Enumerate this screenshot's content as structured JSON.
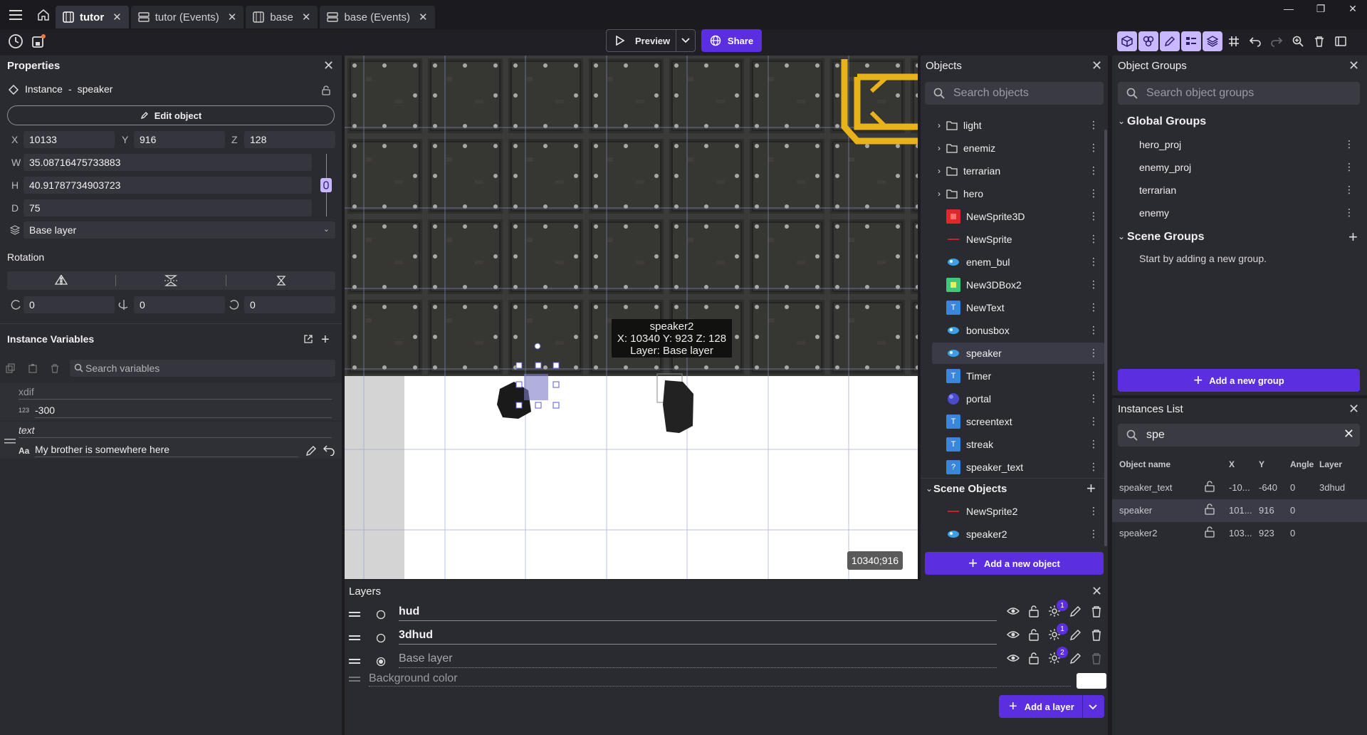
{
  "tabs": [
    {
      "label": "tutor",
      "active": true,
      "icon": "film-icon"
    },
    {
      "label": "tutor (Events)",
      "active": false,
      "icon": "list-icon"
    },
    {
      "label": "base",
      "active": false,
      "icon": "film-icon"
    },
    {
      "label": "base (Events)",
      "active": false,
      "icon": "list-icon"
    }
  ],
  "toolbar": {
    "preview_label": "Preview",
    "share_label": "Share"
  },
  "properties": {
    "title": "Properties",
    "instance_label": "Instance",
    "instance_sep": "-",
    "instance_name": "speaker",
    "edit_object_label": "Edit object",
    "x_label": "X",
    "x_value": "10133",
    "y_label": "Y",
    "y_value": "916",
    "z_label": "Z",
    "z_value": "128",
    "w_label": "W",
    "w_value": "35.08716475733883",
    "h_label": "H",
    "h_value": "40.91787734903723",
    "d_label": "D",
    "d_value": "75",
    "layer_value": "Base layer",
    "rotation_label": "Rotation",
    "rot_x": "0",
    "rot_y": "0",
    "rot_z": "0"
  },
  "instance_variables": {
    "title": "Instance Variables",
    "search_placeholder": "Search variables",
    "vars": [
      {
        "name": "xdif",
        "type_icon": "123",
        "value": "-300"
      },
      {
        "name": "text",
        "type_icon": "Aa",
        "value": "My brother is somewhere here"
      }
    ]
  },
  "canvas": {
    "tooltip_name": "speaker2",
    "tooltip_coords": "X: 10340  Y: 923  Z: 128",
    "tooltip_layer": "Layer: Base layer",
    "cursor_coords": "10340;916"
  },
  "objects": {
    "title": "Objects",
    "search_placeholder": "Search objects",
    "folders": [
      "light",
      "enemiz",
      "terrarian",
      "hero"
    ],
    "items": [
      {
        "name": "NewSprite3D",
        "icon": "sprite3d-icon",
        "color": "#e0282c"
      },
      {
        "name": "NewSprite",
        "icon": "sprite-icon",
        "color": "#c9202a"
      },
      {
        "name": "enem_bul",
        "icon": "particle-icon",
        "color": "#3aa0e8"
      },
      {
        "name": "New3DBox2",
        "icon": "box3d-icon",
        "color": "#3fc87a"
      },
      {
        "name": "NewText",
        "icon": "text-icon",
        "color": "#3b86d8"
      },
      {
        "name": "bonusbox",
        "icon": "particle-icon",
        "color": "#3aa0e8"
      },
      {
        "name": "speaker",
        "icon": "particle-icon",
        "color": "#3aa0e8",
        "selected": true
      },
      {
        "name": "Timer",
        "icon": "text-icon",
        "color": "#3b86d8"
      },
      {
        "name": "portal",
        "icon": "sphere-icon",
        "color": "#4a4ad0"
      },
      {
        "name": "screentext",
        "icon": "text-icon",
        "color": "#3b86d8"
      },
      {
        "name": "streak",
        "icon": "text-icon",
        "color": "#3b86d8"
      },
      {
        "name": "speaker_text",
        "icon": "unknown-icon",
        "color": "#3b86d8"
      }
    ],
    "scene_objects_label": "Scene Objects",
    "scene_items": [
      {
        "name": "NewSprite2",
        "icon": "sprite-icon",
        "color": "#c9202a"
      },
      {
        "name": "speaker2",
        "icon": "particle-icon",
        "color": "#3aa0e8"
      }
    ],
    "add_object_label": "Add a new object"
  },
  "object_groups": {
    "title": "Object Groups",
    "search_placeholder": "Search object groups",
    "global_label": "Global Groups",
    "global_groups": [
      "hero_proj",
      "enemy_proj",
      "terrarian",
      "enemy"
    ],
    "scene_label": "Scene Groups",
    "scene_empty": "Start by adding a new group.",
    "add_group_label": "Add a new group"
  },
  "instances_list": {
    "title": "Instances List",
    "search_value": "spe",
    "headers": [
      "Object name",
      "X",
      "Y",
      "Angle",
      "Layer"
    ],
    "rows": [
      {
        "name": "speaker_text",
        "x": "-10...",
        "y": "-640",
        "angle": "0",
        "layer": "3dhud"
      },
      {
        "name": "speaker",
        "x": "101...",
        "y": "916",
        "angle": "0",
        "layer": "",
        "selected": true
      },
      {
        "name": "speaker2",
        "x": "103...",
        "y": "923",
        "angle": "0",
        "layer": ""
      }
    ]
  },
  "layers": {
    "title": "Layers",
    "items": [
      {
        "name": "hud",
        "effects": "1"
      },
      {
        "name": "3dhud",
        "effects": "1"
      },
      {
        "name": "Base layer",
        "effects": "2"
      }
    ],
    "background_label": "Background color",
    "add_layer_label": "Add a layer"
  }
}
